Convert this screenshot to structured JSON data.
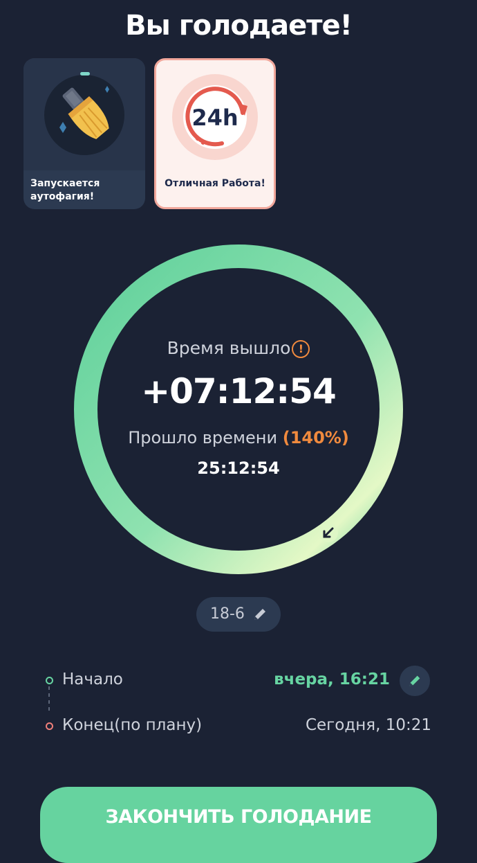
{
  "header": {
    "title": "Вы голодаете!"
  },
  "cards": [
    {
      "label": "Запускается аутофагия!",
      "icon": "brush-icon"
    },
    {
      "label": "Отличная Работа!",
      "badge": "24h",
      "icon": "24h-badge-icon"
    }
  ],
  "timer": {
    "time_out_label": "Время вышло",
    "overtime": "+07:12:54",
    "elapsed_label": "Прошло времени",
    "elapsed_percent": "(140%)",
    "elapsed": "25:12:54",
    "progress_fraction": 1.0
  },
  "plan": {
    "label": "18-6"
  },
  "schedule": {
    "start_label": "Начало",
    "start_value": "вчера, 16:21",
    "end_label": "Конец(по плану)",
    "end_value": "Сегодня, 10:21"
  },
  "actions": {
    "end_fast_label": "ЗАКОНЧИТЬ ГОЛОДАНИЕ"
  },
  "colors": {
    "background": "#1b2234",
    "accent_green": "#66d39f",
    "accent_orange": "#f08a3e",
    "accent_red": "#ef7f7a"
  }
}
